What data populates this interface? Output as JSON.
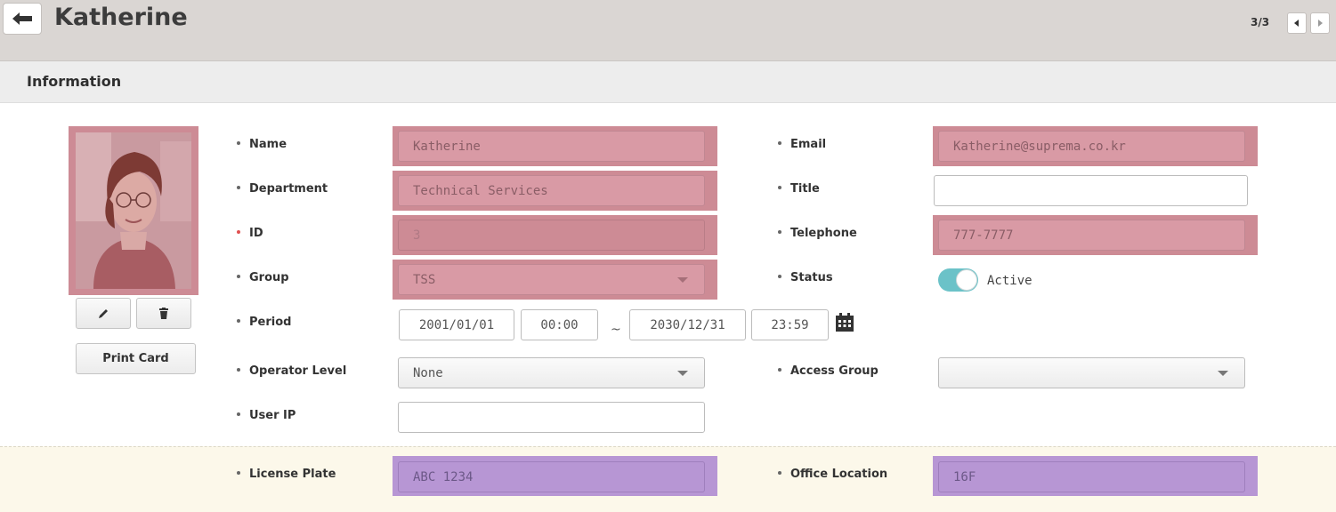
{
  "header": {
    "title": "Katherine",
    "pager": "3/3"
  },
  "panel": {
    "title": "Information",
    "print_card": "Print Card"
  },
  "labels": {
    "name": "Name",
    "department": "Department",
    "id": "ID",
    "group": "Group",
    "period": "Period",
    "operator_level": "Operator Level",
    "user_ip": "User IP",
    "email": "Email",
    "title": "Title",
    "telephone": "Telephone",
    "status": "Status",
    "access_group": "Access Group",
    "license_plate": "License Plate",
    "office_location": "Office Location"
  },
  "values": {
    "name": "Katherine",
    "department": "Technical Services",
    "id": "3",
    "group": "TSS",
    "period_start_date": "2001/01/01",
    "period_start_time": "00:00",
    "period_sep": "~",
    "period_end_date": "2030/12/31",
    "period_end_time": "23:59",
    "operator_level": "None",
    "user_ip": "",
    "email": "Katherine@suprema.co.kr",
    "title": "",
    "telephone": "777-7777",
    "status": "Active",
    "access_group": "",
    "license_plate": "ABC 1234",
    "office_location": "16F"
  },
  "icons": {
    "back": "arrow-left-icon",
    "prev": "caret-left-icon",
    "next": "caret-right-icon",
    "edit": "pencil-icon",
    "delete": "trash-icon",
    "calendar": "calendar-icon"
  },
  "colors": {
    "highlight_red": "#cd8b95",
    "highlight_purple": "#b796d4",
    "toggle_on": "#6bc2c8",
    "footer_band": "#fcf8ea"
  }
}
